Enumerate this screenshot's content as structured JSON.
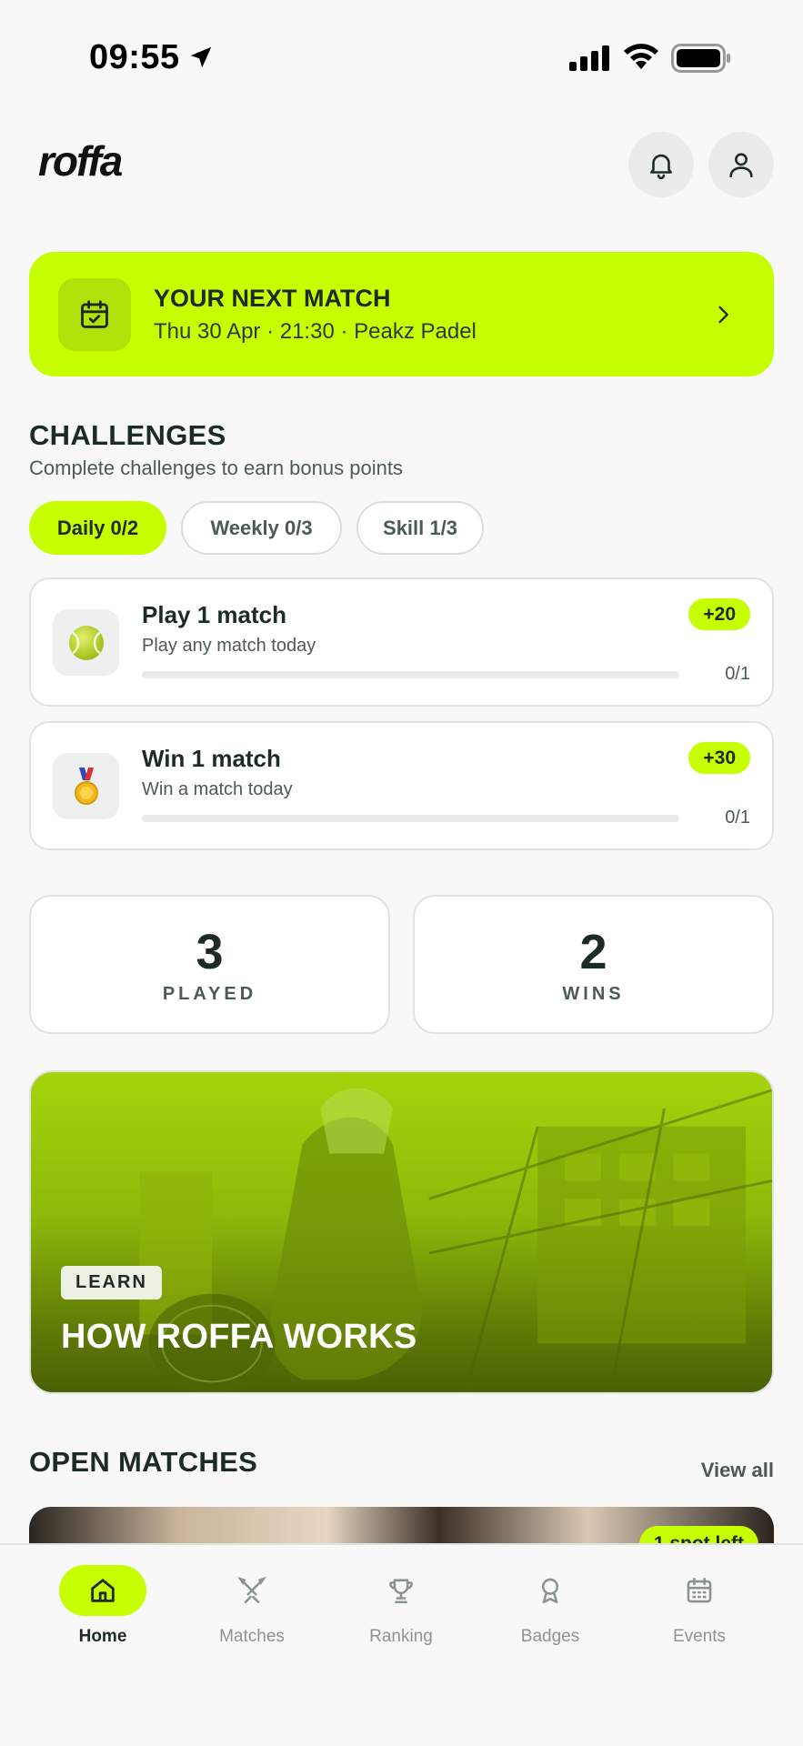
{
  "status_bar": {
    "time": "09:55"
  },
  "header": {
    "logo": "roffa",
    "notifications_icon": "bell-icon",
    "profile_icon": "user-icon"
  },
  "next_match": {
    "title": "YOUR NEXT MATCH",
    "detail": "Thu 30 Apr · 21:30 · Peakz Padel",
    "icon": "calendar-check-icon"
  },
  "challenges": {
    "title": "CHALLENGES",
    "subtitle": "Complete challenges to earn bonus points",
    "tabs": [
      {
        "label": "Daily 0/2",
        "active": true
      },
      {
        "label": "Weekly 0/3",
        "active": false
      },
      {
        "label": "Skill 1/3",
        "active": false
      }
    ],
    "items": [
      {
        "title": "Play 1 match",
        "description": "Play any match today",
        "points": "+20",
        "progress_text": "0/1",
        "progress": 0,
        "icon": "tennis-ball-icon"
      },
      {
        "title": "Win 1 match",
        "description": "Win a match today",
        "points": "+30",
        "progress_text": "0/1",
        "progress": 0,
        "icon": "medal-icon"
      }
    ]
  },
  "stats": [
    {
      "value": "3",
      "label": "PLAYED"
    },
    {
      "value": "2",
      "label": "WINS"
    }
  ],
  "learn_banner": {
    "tag": "LEARN",
    "title": "HOW ROFFA WORKS"
  },
  "open_matches": {
    "title": "OPEN MATCHES",
    "view_all": "View all",
    "first_card_badge": "1 spot left"
  },
  "tabbar": [
    {
      "label": "Home",
      "icon": "home-icon",
      "active": true
    },
    {
      "label": "Matches",
      "icon": "crossed-rackets-icon",
      "active": false
    },
    {
      "label": "Ranking",
      "icon": "trophy-icon",
      "active": false
    },
    {
      "label": "Badges",
      "icon": "award-icon",
      "active": false
    },
    {
      "label": "Events",
      "icon": "calendar-icon",
      "active": false
    }
  ],
  "colors": {
    "accent": "#c6ff00",
    "text_dark": "#1d2b27",
    "text_muted": "#4b5a56",
    "background": "#f8f8f8"
  }
}
